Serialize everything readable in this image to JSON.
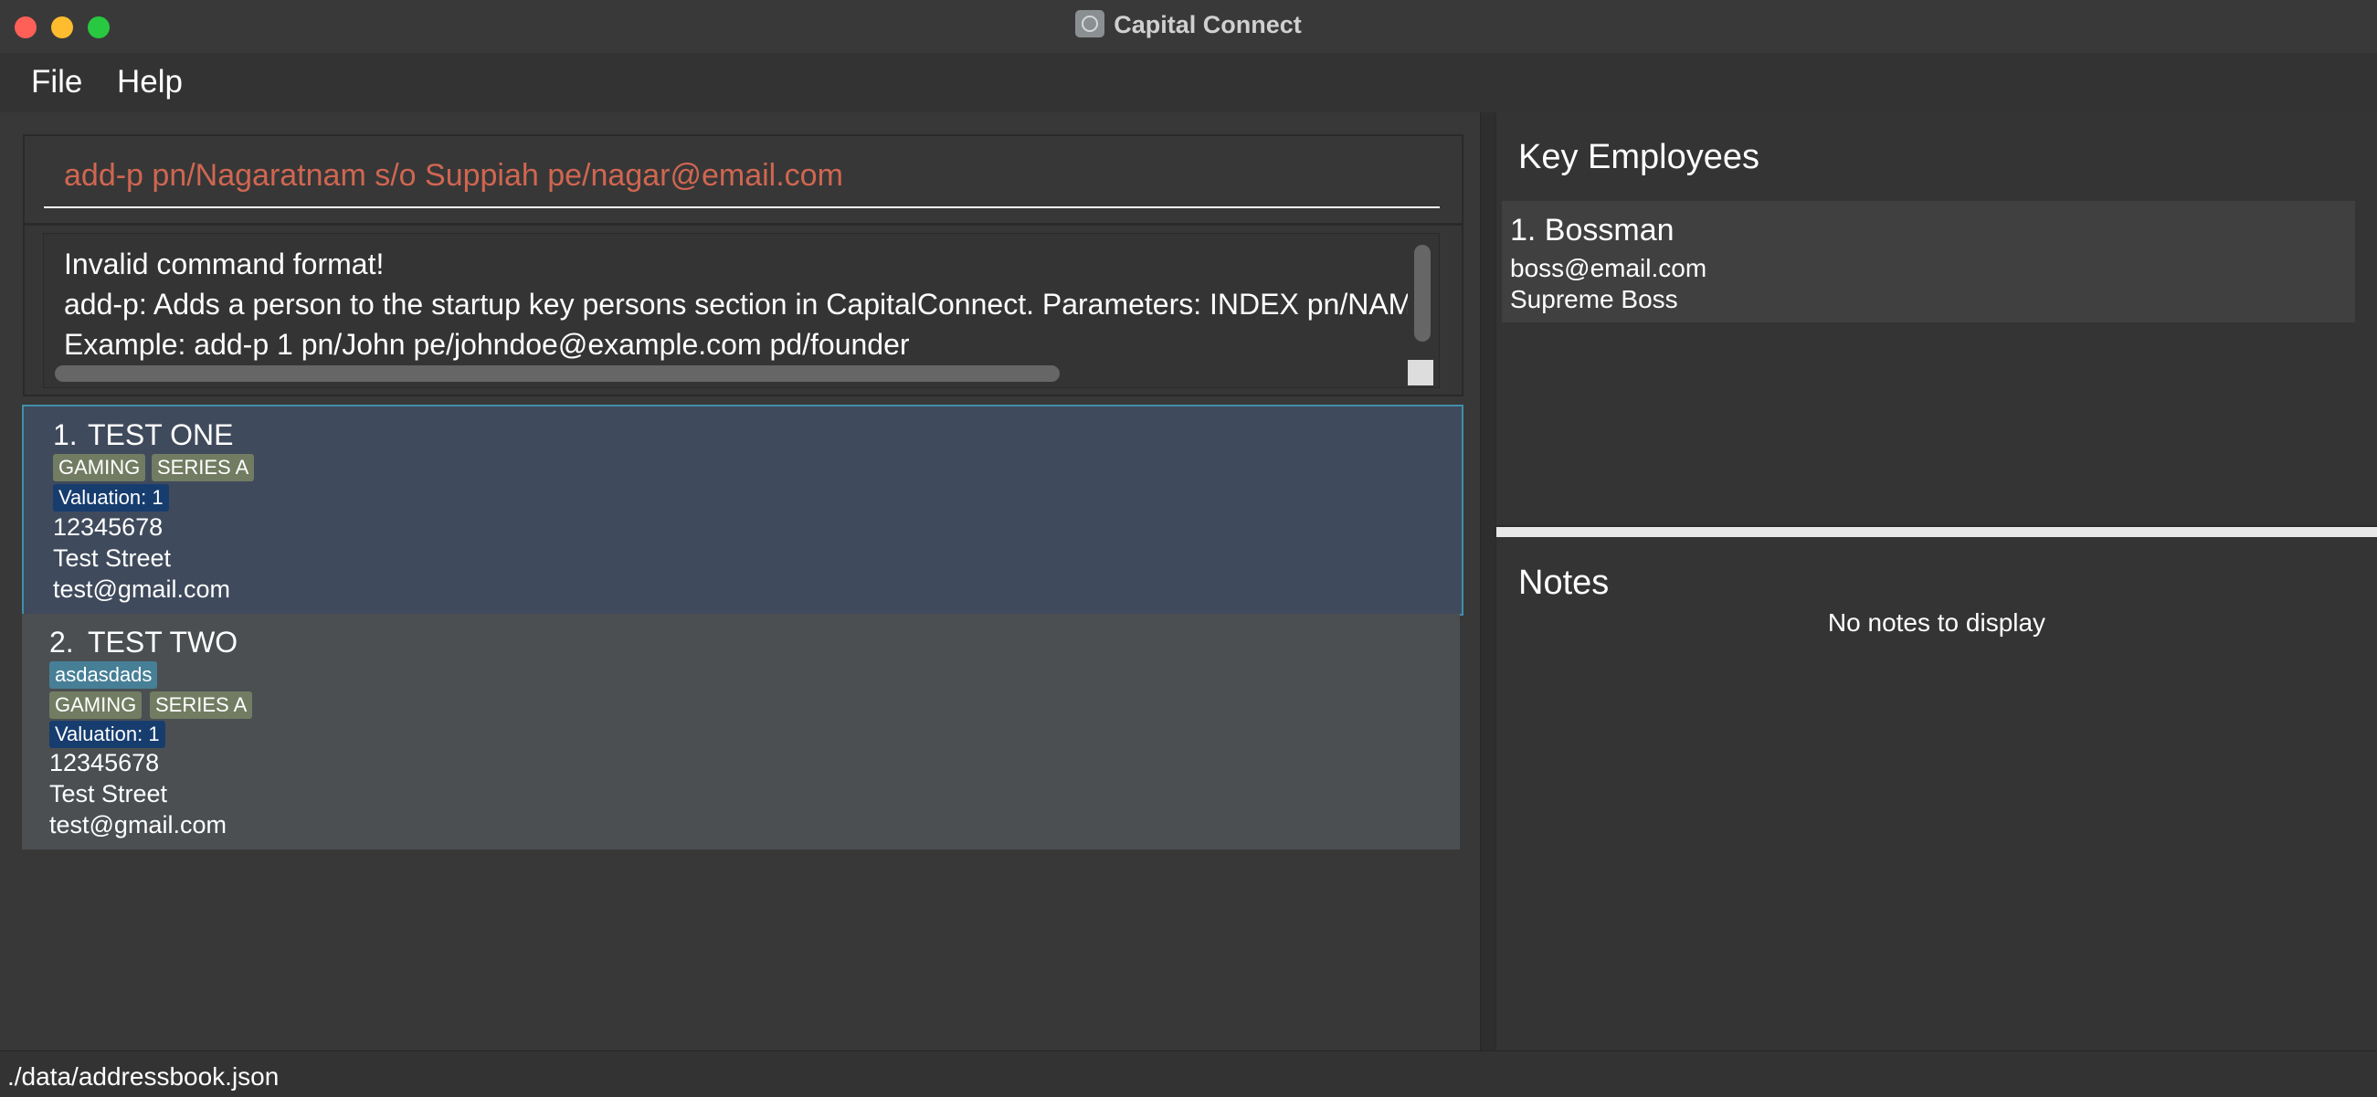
{
  "window": {
    "title": "Capital Connect"
  },
  "menu": {
    "file": "File",
    "help": "Help"
  },
  "command": {
    "value": "add-p pn/Nagaratnam s/o Suppiah pe/nagar@email.com"
  },
  "result": {
    "lines": [
      "Invalid command format!",
      "add-p: Adds a person to the startup key persons section in CapitalConnect. Parameters: INDEX pn/NAME pe/EMAIL pd/DESCRIPTION",
      "Example: add-p 1 pn/John pe/johndoe@example.com pd/founder"
    ]
  },
  "startups": [
    {
      "index": "1.",
      "name": "TEST ONE",
      "notes_tags": [],
      "tags": [
        "GAMING",
        "SERIES A"
      ],
      "valuation": "Valuation: 1",
      "phone": "12345678",
      "address": "Test Street",
      "email": "test@gmail.com",
      "selected": true
    },
    {
      "index": "2.",
      "name": "TEST TWO",
      "notes_tags": [
        "asdasdads"
      ],
      "tags": [
        "GAMING",
        "SERIES A"
      ],
      "valuation": "Valuation: 1",
      "phone": "12345678",
      "address": "Test Street",
      "email": "test@gmail.com",
      "selected": false
    }
  ],
  "key_employees": {
    "title": "Key Employees",
    "items": [
      {
        "label": "1. Bossman",
        "email": "boss@email.com",
        "description": "Supreme Boss"
      }
    ]
  },
  "notes": {
    "title": "Notes",
    "empty": "No notes to display"
  },
  "status": {
    "path": "./data/addressbook.json"
  },
  "colors": {
    "command_text": "#d06651",
    "selected_card": "#3f4a5c",
    "tag_industry": "#727c62",
    "tag_valuation": "#173d6f",
    "tag_note": "#477f97"
  }
}
